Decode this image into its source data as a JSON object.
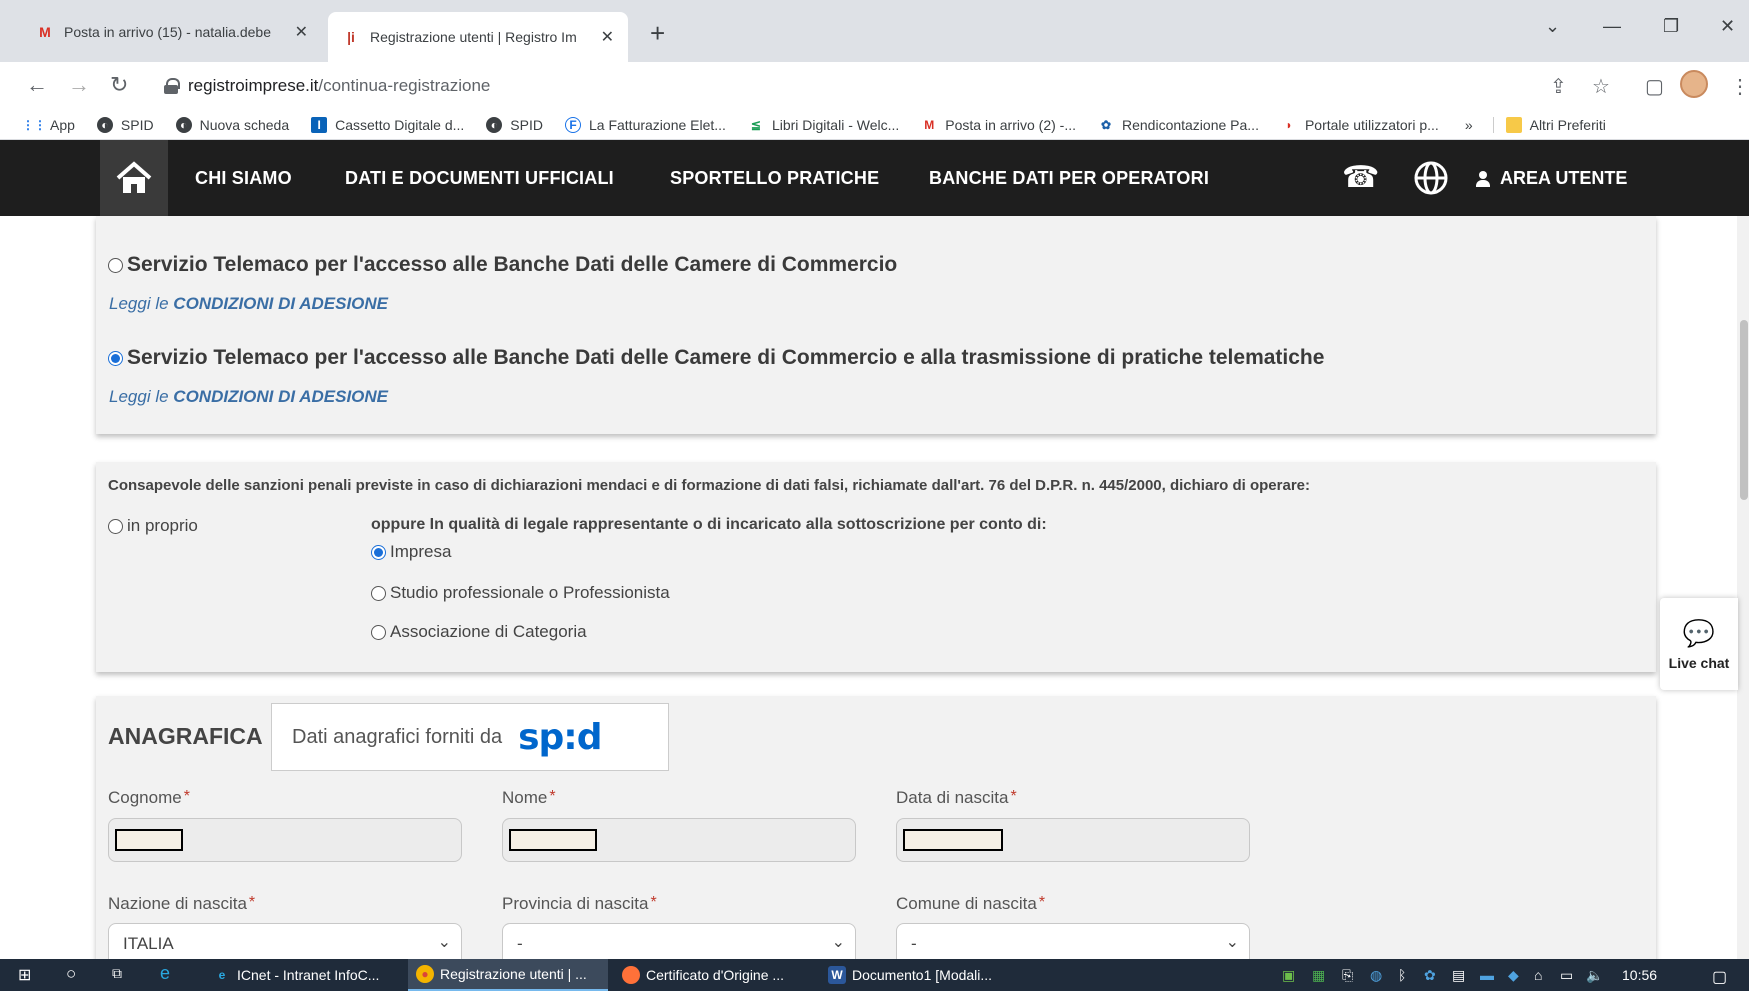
{
  "browser": {
    "tabs": [
      {
        "title": "Posta in arrivo (15) - natalia.debe",
        "favicon": "gmail-icon",
        "active": false
      },
      {
        "title": "Registrazione utenti | Registro Im",
        "favicon": "registro-imprese-icon",
        "active": true
      }
    ],
    "new_tab": "+",
    "url_host": "registroimprese.it",
    "url_path": "/continua-registrazione",
    "bookmarks": [
      {
        "label": "App",
        "icon": "apps-grid-icon"
      },
      {
        "label": "SPID",
        "icon": "globe-icon"
      },
      {
        "label": "Nuova scheda",
        "icon": "globe-icon"
      },
      {
        "label": "Cassetto Digitale d...",
        "icon": "cassetto-icon"
      },
      {
        "label": "SPID",
        "icon": "globe-icon"
      },
      {
        "label": "La Fatturazione Elet...",
        "icon": "fattura-icon"
      },
      {
        "label": "Libri Digitali - Welc...",
        "icon": "libri-icon"
      },
      {
        "label": "Posta in arrivo (2) -...",
        "icon": "gmail-icon"
      },
      {
        "label": "Rendicontazione Pa...",
        "icon": "rendicontazione-icon"
      },
      {
        "label": "Portale utilizzatori p...",
        "icon": "portale-icon"
      },
      {
        "label": "»",
        "icon": ""
      },
      {
        "label": "Altri Preferiti",
        "icon": "folder-icon"
      }
    ]
  },
  "site_nav": {
    "items": [
      "CHI SIAMO",
      "DATI E DOCUMENTI UFFICIALI",
      "SPORTELLO PRATICHE",
      "BANCHE DATI PER OPERATORI"
    ],
    "area_utente": "AREA UTENTE"
  },
  "services": [
    {
      "label": "Servizio Telemaco per l'accesso alle Banche Dati delle Camere di Commercio",
      "selected": false,
      "link_prefix": "Leggi le",
      "link_text": "CONDIZIONI DI ADESIONE"
    },
    {
      "label": "Servizio Telemaco per l'accesso alle Banche Dati delle Camere di Commercio e alla trasmissione di pratiche telematiche",
      "selected": true,
      "link_prefix": "Leggi le",
      "link_text": "CONDIZIONI DI ADESIONE"
    }
  ],
  "declaration": {
    "text": "Consapevole delle sanzioni penali previste in caso di dichiarazioni mendaci e di formazione di dati falsi, richiamate dall'art. 76 del D.P.R. n. 445/2000, dichiaro di operare:",
    "in_proprio": "in proprio",
    "oppure": "oppure In qualità di legale rappresentante o di incaricato  alla sottoscrizione per conto di:",
    "options": [
      {
        "label": "Impresa",
        "selected": true
      },
      {
        "label": "Studio professionale o Professionista",
        "selected": false
      },
      {
        "label": "Associazione di Categoria",
        "selected": false
      }
    ]
  },
  "anagrafica": {
    "title": "ANAGRAFICA",
    "spid_text": "Dati anagrafici forniti da",
    "spid_logo": "sp:d",
    "fields": {
      "cognome": "Cognome",
      "nome": "Nome",
      "data_nascita": "Data di nascita",
      "nazione": "Nazione di nascita",
      "provincia": "Provincia di nascita",
      "comune": "Comune di nascita"
    },
    "required_mark": "*",
    "nazione_value": "ITALIA",
    "provincia_value": "-",
    "comune_value": "-"
  },
  "live_chat": "Live chat",
  "taskbar": {
    "items": [
      {
        "label": "ICnet - Intranet InfoC...",
        "icon": "ie-icon"
      },
      {
        "label": "Registrazione utenti | ...",
        "icon": "chrome-icon",
        "active": true
      },
      {
        "label": "Certificato d'Origine ...",
        "icon": "firefox-icon"
      },
      {
        "label": "Documento1 [Modali...",
        "icon": "word-icon"
      }
    ],
    "clock": "10:56"
  },
  "colors": {
    "nav_bg": "#1e1e1e",
    "panel_bg": "#f2f2f2",
    "link": "#3a6ea5",
    "radio_selected": "#1a6fd8",
    "required": "#c0392b",
    "spid_blue": "#0066cc"
  }
}
